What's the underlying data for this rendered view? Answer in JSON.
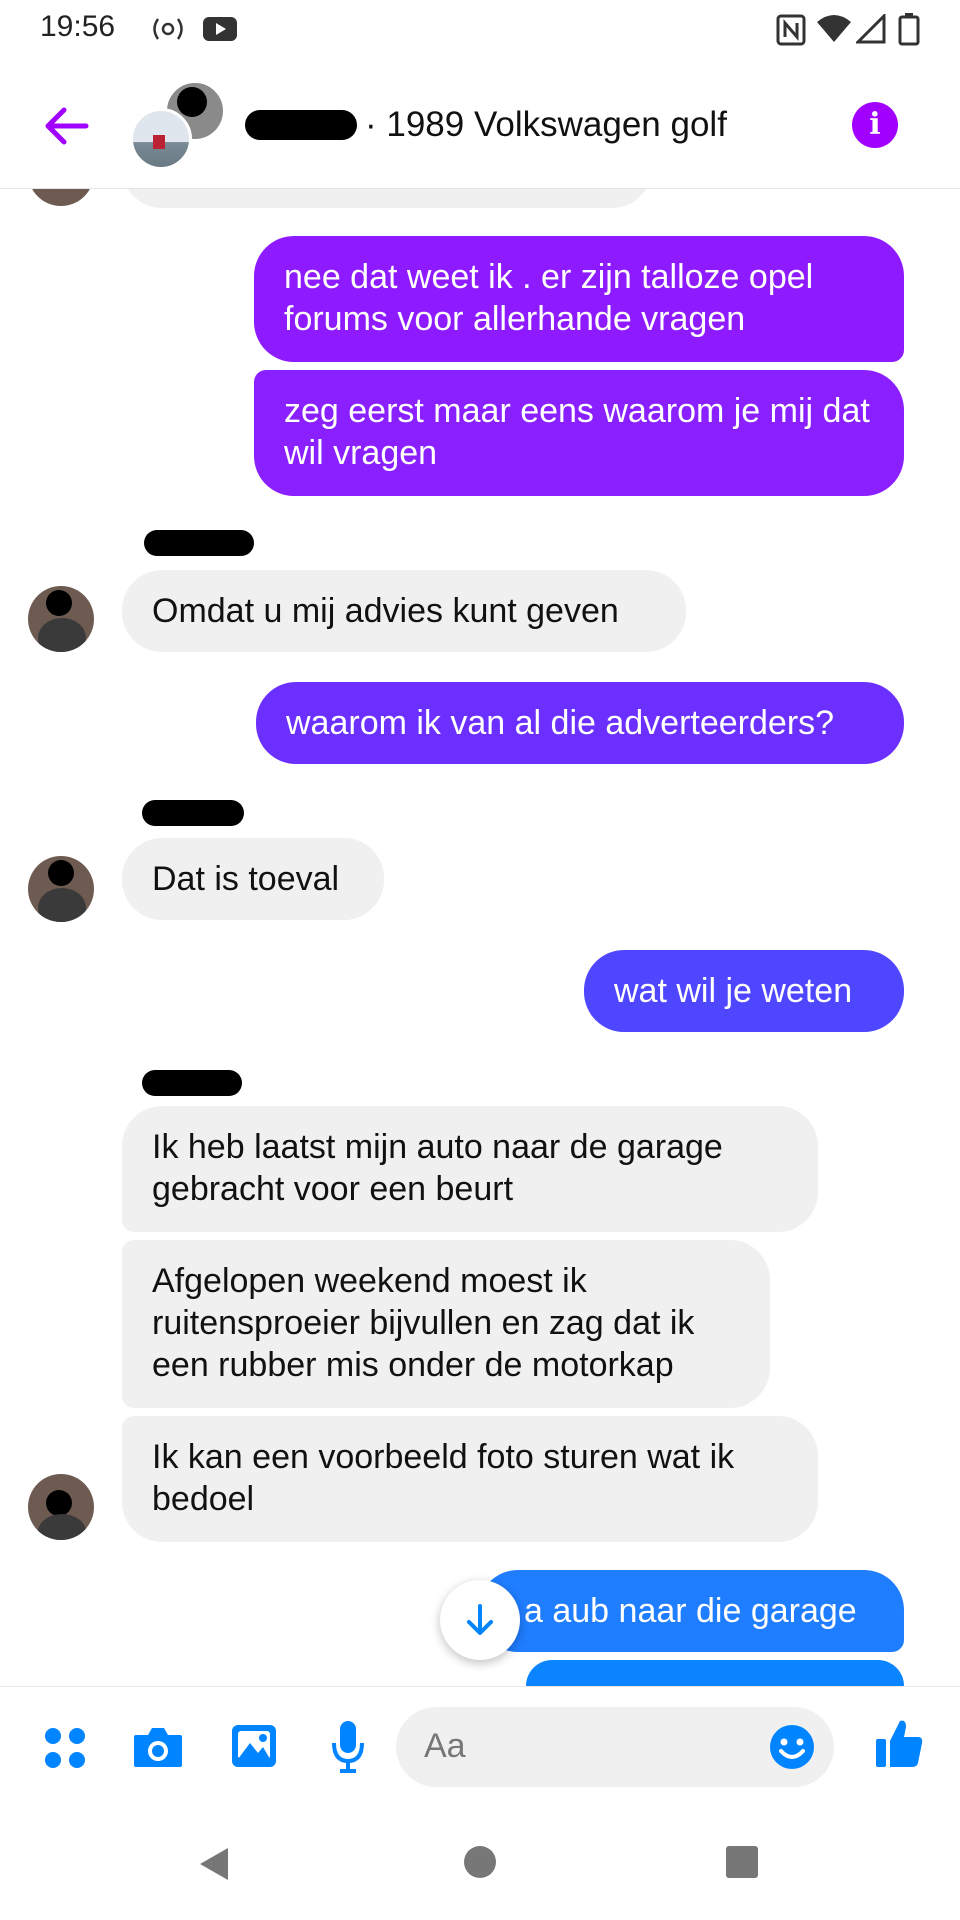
{
  "status_bar": {
    "time": "19:56"
  },
  "header": {
    "title": "· 1989 Volkswagen golf"
  },
  "messages": {
    "out1": "nee dat weet ik . er zijn talloze opel forums voor allerhande vragen",
    "out2": "zeg eerst maar eens waarom je mij dat wil vragen",
    "in1": "Omdat u mij advies kunt geven",
    "out3": "waarom ik van al die adverteerders?",
    "in2": "Dat is toeval",
    "out4": "wat wil je weten",
    "in3": "Ik heb laatst mijn auto naar de garage gebracht voor een beurt",
    "in4": "Afgelopen weekend moest ik ruitensproeier bijvullen en zag dat ik een rubber mis onder de motorkap",
    "in5": "Ik kan een voorbeeld foto sturen wat ik bedoel",
    "out5": "a aub naar die garage"
  },
  "composer": {
    "placeholder": "Aa"
  },
  "colors": {
    "accent": "#a100ff",
    "blue": "#0084ff",
    "purple_bubble": "#8a1cff",
    "indigo_bubble": "#5b3cff"
  },
  "icons": [
    "back-arrow-icon",
    "info-icon",
    "apps-icon",
    "camera-icon",
    "image-icon",
    "mic-icon",
    "emoji-icon",
    "thumbs-up-icon",
    "scroll-down-icon",
    "nav-back-icon",
    "nav-home-icon",
    "nav-recents-icon"
  ]
}
